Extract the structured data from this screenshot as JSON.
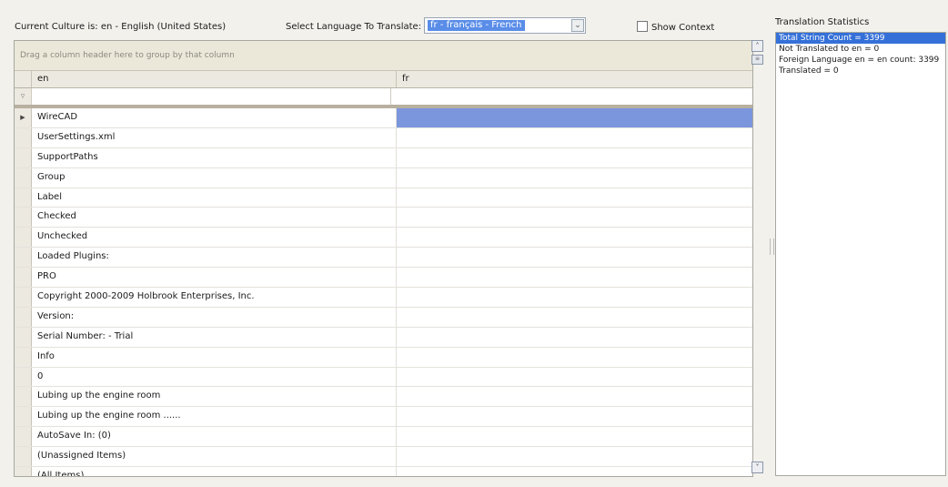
{
  "header": {
    "culture_label": "Current Culture is: en - English (United States)",
    "select_label": "Select Language To Translate:",
    "selected_language": "fr - français - French",
    "show_context_label": "Show Context"
  },
  "grid": {
    "group_hint": "Drag a column header here to group by that column",
    "columns": [
      "en",
      "fr"
    ],
    "filter_icon": "filter-icon",
    "rows": [
      {
        "en": "WireCAD",
        "fr": ""
      },
      {
        "en": "UserSettings.xml",
        "fr": ""
      },
      {
        "en": "SupportPaths",
        "fr": ""
      },
      {
        "en": "Group",
        "fr": ""
      },
      {
        "en": "Label",
        "fr": ""
      },
      {
        "en": "Checked",
        "fr": ""
      },
      {
        "en": "Unchecked",
        "fr": ""
      },
      {
        "en": "Loaded Plugins:",
        "fr": ""
      },
      {
        "en": "PRO",
        "fr": ""
      },
      {
        "en": "Copyright 2000-2009 Holbrook Enterprises, Inc.",
        "fr": ""
      },
      {
        "en": "Version:",
        "fr": ""
      },
      {
        "en": "Serial Number: - Trial",
        "fr": ""
      },
      {
        "en": "Info",
        "fr": ""
      },
      {
        "en": "0",
        "fr": ""
      },
      {
        "en": "Lubing up the engine room",
        "fr": ""
      },
      {
        "en": "Lubing up the engine room ......",
        "fr": ""
      },
      {
        "en": "AutoSave In: (0)",
        "fr": ""
      },
      {
        "en": "(Unassigned Items)",
        "fr": ""
      },
      {
        "en": "(All Items)",
        "fr": ""
      }
    ]
  },
  "stats": {
    "title": "Translation Statistics",
    "items": [
      "Total String Count = 3399",
      "Not Translated to en = 0",
      "Foreign Language en = en count: 3399",
      "Translated = 0"
    ]
  },
  "colors": {
    "selection_blue": "#3470d8",
    "row_selection": "#7b96dd",
    "panel_bg": "#ece8d9"
  }
}
